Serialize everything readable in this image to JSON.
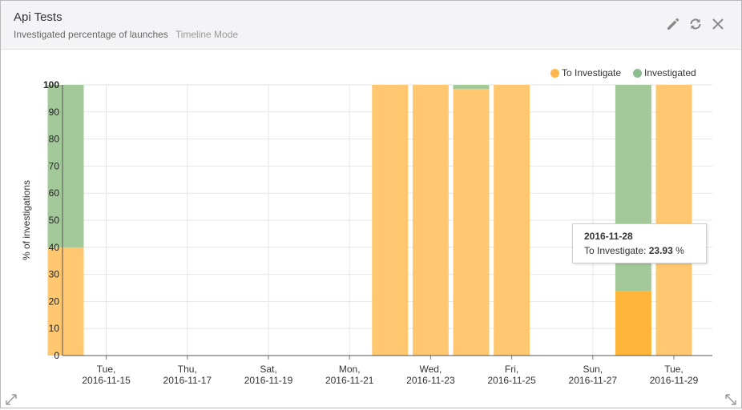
{
  "widget": {
    "title": "Api Tests",
    "subtitle": "Investigated percentage of launches",
    "mode": "Timeline Mode"
  },
  "icons": {
    "edit": "pencil-icon",
    "refresh": "refresh-icon",
    "close": "close-icon",
    "resize_left": "resize-diagonal-icon",
    "resize_right": "resize-diagonal-icon"
  },
  "legend": [
    {
      "label": "To Investigate",
      "color": "#ffb74d"
    },
    {
      "label": "Investigated",
      "color": "#8fbc8f"
    }
  ],
  "tooltip": {
    "date": "2016-11-28",
    "label": "To Investigate: ",
    "value": "23.93",
    "unit": " %"
  },
  "chart_data": {
    "type": "bar",
    "stacked": true,
    "ylabel": "% of investigations",
    "ylim": [
      0,
      100
    ],
    "yticks": [
      0,
      10,
      20,
      30,
      40,
      50,
      60,
      70,
      80,
      90,
      100
    ],
    "grid": true,
    "legend_position": "top-right",
    "x_tick_labels": [
      {
        "day": "Tue,",
        "date": "2016-11-15"
      },
      {
        "day": "Thu,",
        "date": "2016-11-17"
      },
      {
        "day": "Sat,",
        "date": "2016-11-19"
      },
      {
        "day": "Mon,",
        "date": "2016-11-21"
      },
      {
        "day": "Wed,",
        "date": "2016-11-23"
      },
      {
        "day": "Fri,",
        "date": "2016-11-25"
      },
      {
        "day": "Sun,",
        "date": "2016-11-27"
      },
      {
        "day": "Tue,",
        "date": "2016-11-29"
      }
    ],
    "categories": [
      "2016-11-14",
      "2016-11-22",
      "2016-11-23",
      "2016-11-24",
      "2016-11-25",
      "2016-11-28",
      "2016-11-29"
    ],
    "series": [
      {
        "name": "To Investigate",
        "color": "#ffc870",
        "values": [
          40,
          100,
          100,
          98.5,
          100,
          23.93,
          100
        ]
      },
      {
        "name": "Investigated",
        "color": "#a3c99a",
        "values": [
          60,
          0,
          0,
          1.5,
          0,
          76.07,
          0
        ]
      }
    ],
    "highlighted": {
      "category": "2016-11-28",
      "series": "To Investigate",
      "color": "#ffb43a"
    }
  }
}
